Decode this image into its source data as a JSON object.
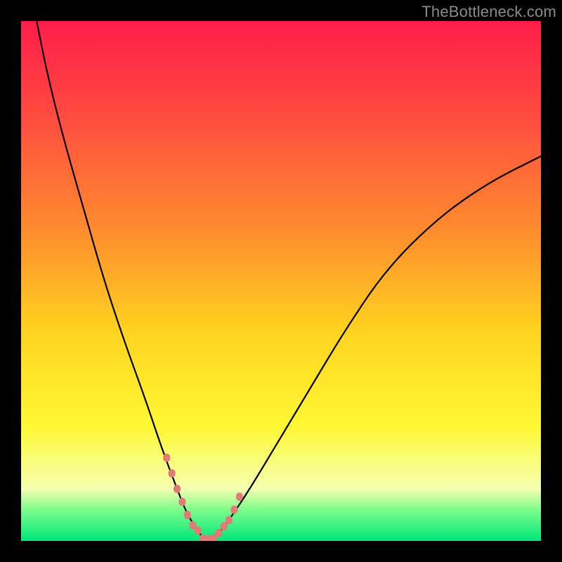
{
  "watermark": "TheBottleneck.com",
  "chart_data": {
    "type": "line",
    "title": "",
    "xlabel": "",
    "ylabel": "",
    "xlim": [
      0,
      100
    ],
    "ylim": [
      0,
      100
    ],
    "grid": false,
    "highlight_band_x": [
      28,
      42
    ],
    "bottom_stripe": {
      "color_top": "#7dfc8c",
      "color_bottom": "#00e77a",
      "y_range": [
        0,
        6
      ]
    },
    "series": [
      {
        "name": "bottleneck-curve",
        "color": "#000000",
        "x": [
          3,
          5,
          8,
          12,
          16,
          20,
          24,
          27,
          30,
          32,
          34,
          35,
          36,
          37,
          38,
          40,
          44,
          50,
          56,
          62,
          70,
          80,
          90,
          100
        ],
        "y": [
          100,
          90,
          78,
          64,
          50,
          38,
          27,
          18,
          10,
          5,
          2,
          0.5,
          0.3,
          0.5,
          1.5,
          4,
          10,
          20,
          30,
          40,
          52,
          62,
          69,
          74
        ]
      },
      {
        "name": "highlight-points",
        "color": "#e07b78",
        "style": "dots",
        "x": [
          28,
          29,
          30,
          31,
          32,
          33,
          34,
          35,
          36,
          37,
          38,
          39,
          40,
          41,
          42
        ],
        "y": [
          16,
          13,
          10,
          7.5,
          5,
          3,
          2,
          0.5,
          0.3,
          0.5,
          1.5,
          2.8,
          4,
          6,
          8.5
        ]
      }
    ],
    "gradient_stops": [
      {
        "offset": 0.0,
        "color": "#ff1d4a"
      },
      {
        "offset": 0.18,
        "color": "#ff4a40"
      },
      {
        "offset": 0.4,
        "color": "#ff8b2e"
      },
      {
        "offset": 0.6,
        "color": "#ffd41f"
      },
      {
        "offset": 0.78,
        "color": "#fff833"
      },
      {
        "offset": 0.9,
        "color": "#f4ffb0"
      },
      {
        "offset": 0.94,
        "color": "#7dfc8c"
      },
      {
        "offset": 1.0,
        "color": "#00e77a"
      }
    ]
  }
}
